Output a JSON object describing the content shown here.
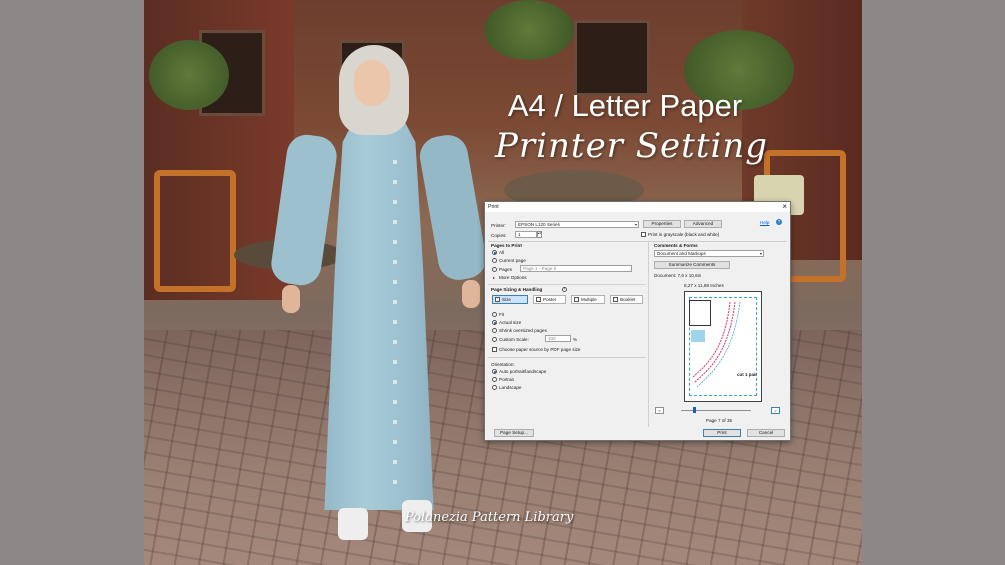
{
  "overlay": {
    "title_line1": "A4 / Letter Paper",
    "title_line2": "Printer Setting",
    "watermark": "Polanezia Pattern Library"
  },
  "dialog": {
    "title": "Print",
    "close_icon": "close-icon",
    "printer_label": "Printer:",
    "printer_value": "EPSON L120 Series",
    "properties_label": "Properties",
    "advanced_label": "Advanced",
    "help_label": "Help",
    "copies_label": "Copies:",
    "copies_value": "1",
    "grayscale_label": "Print in grayscale (black and white)",
    "pages_to_print": {
      "heading": "Pages to Print",
      "all_label": "All",
      "current_page_label": "Current page",
      "pages_label": "Pages",
      "pages_placeholder": "Page 1 - Page 6",
      "more_options_label": "More Options",
      "selected": "All"
    },
    "page_sizing": {
      "heading": "Page Sizing & Handling",
      "tabs": [
        {
          "label": "Size",
          "icon": "size-icon"
        },
        {
          "label": "Poster",
          "icon": "poster-icon"
        },
        {
          "label": "Multiple",
          "icon": "multiple-icon"
        },
        {
          "label": "Booklet",
          "icon": "booklet-icon"
        }
      ],
      "active_tab": "Size",
      "fit_label": "Fit",
      "actual_size_label": "Actual size",
      "shrink_label": "Shrink oversized pages",
      "custom_scale_label": "Custom Scale:",
      "custom_scale_value": "100",
      "percent_sign": "%",
      "paper_source_label": "Choose paper source by PDF page size",
      "selected": "Actual size"
    },
    "orientation": {
      "heading": "Orientation:",
      "auto_label": "Auto portrait/landscape",
      "portrait_label": "Portrait",
      "landscape_label": "Landscape",
      "selected": "Auto portrait/landscape"
    },
    "comments_forms": {
      "heading": "Comments & Forms",
      "value": "Document and Markups",
      "summarize_label": "Summarize Comments"
    },
    "document_size": "Document: 7,6 x 10,6in",
    "paper_size": "8,27 x 11,69 Inches",
    "preview": {
      "cut_text": "cut 1 pair"
    },
    "page_indicator": "Page 7 of 35",
    "prev_label": "<",
    "next_label": ">",
    "page_setup_label": "Page Setup...",
    "print_label": "Print",
    "cancel_label": "Cancel"
  },
  "colors": {
    "accent": "#1a5fb4",
    "preview_line": "#e0305a",
    "preview_dash": "#3aa6c8"
  }
}
